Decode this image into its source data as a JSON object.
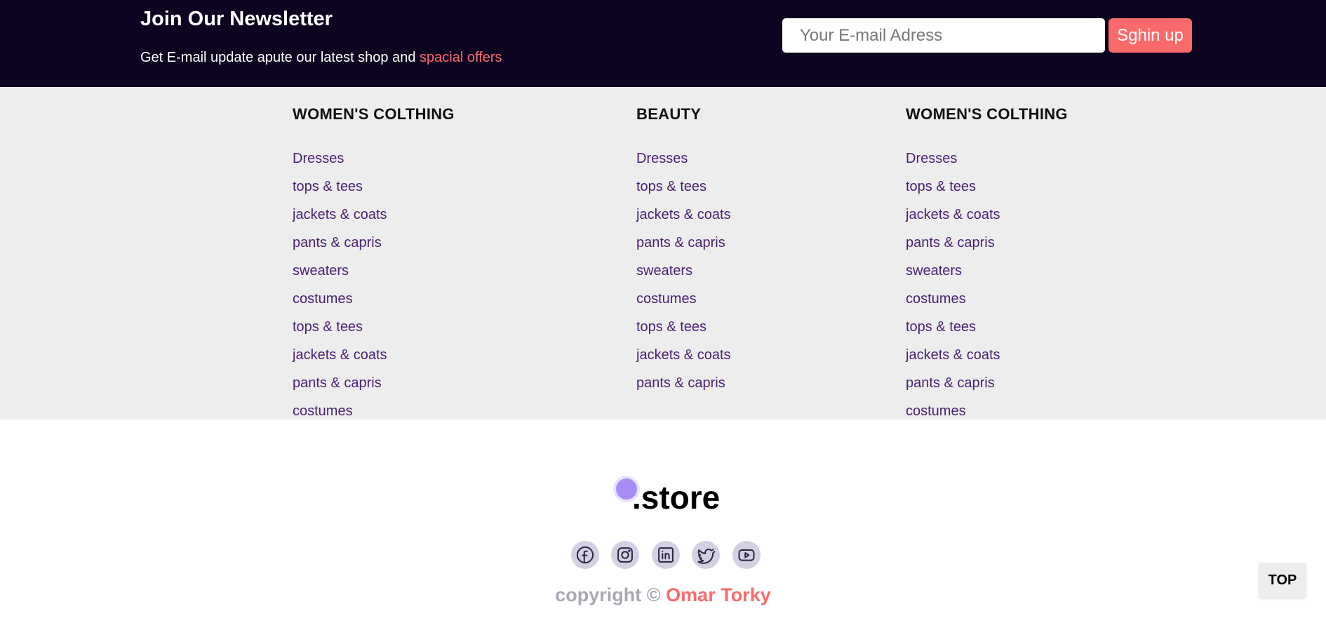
{
  "newsletter": {
    "title": "Join Our Newsletter",
    "subtitle": "Get E-mail update apute our latest shop and",
    "subtitle_accent": "spacial offers",
    "email_placeholder": "Your E-mail Adress",
    "signup_label": "Sghin up"
  },
  "columns": [
    {
      "heading": "WOMEN'S COLTHING",
      "links": [
        "Dresses",
        "tops & tees",
        "jackets & coats",
        "pants & capris",
        "sweaters",
        "costumes",
        "tops & tees",
        "jackets & coats",
        "pants & capris",
        "costumes"
      ]
    },
    {
      "heading": "BEAUTY",
      "links": [
        "Dresses",
        "tops & tees",
        "jackets & coats",
        "pants & capris",
        "sweaters",
        "costumes",
        "tops & tees",
        "jackets & coats",
        "pants & capris"
      ]
    },
    {
      "heading": "WOMEN'S COLTHING",
      "links": [
        "Dresses",
        "tops & tees",
        "jackets & coats",
        "pants & capris",
        "sweaters",
        "costumes",
        "tops & tees",
        "jackets & coats",
        "pants & capris",
        "costumes"
      ]
    }
  ],
  "brand": {
    "name": ".store"
  },
  "socials": [
    {
      "icon": "facebook-icon"
    },
    {
      "icon": "instagram-icon"
    },
    {
      "icon": "linkedin-icon"
    },
    {
      "icon": "twitter-icon"
    },
    {
      "icon": "youtube-icon"
    }
  ],
  "copyright": {
    "prefix": "copyright ©",
    "author": "Omar Torky"
  },
  "top_button": {
    "label": "TOP"
  },
  "colors": {
    "newsletter_bg": "#0c0420",
    "accent": "#fb6a6a",
    "link": "#4b1f72",
    "footer_bg": "#ededed",
    "brand_dot": "#a98cf5"
  }
}
